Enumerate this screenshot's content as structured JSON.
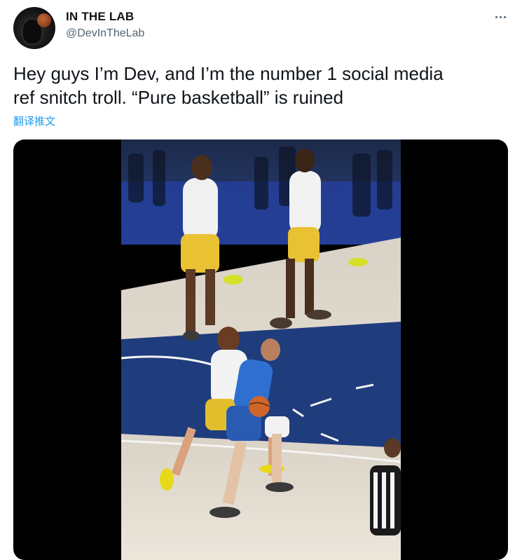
{
  "user": {
    "display_name": "IN THE LAB",
    "handle": "@DevInTheLab",
    "avatar_icon": "avatar-basketball-icon"
  },
  "more_icon": "more-horizontal-icon",
  "tweet": {
    "line1": "Hey guys I’m Dev, and I’m the number 1 social media",
    "line2": "ref snitch troll.  “Pure basketball” is ruined"
  },
  "translate_label": "翻译推文",
  "media": {
    "type": "video",
    "description_icon": "basketball-video-frame"
  },
  "colors": {
    "text": "#0f1419",
    "secondary": "#536471",
    "link": "#1d9bf0",
    "media_bg": "#000000",
    "court_blue": "#1a3a8a",
    "floor": "#e8e2d6",
    "warriors_jersey": "#f2f2f2",
    "mavs_jersey": "#2a6fd1"
  }
}
